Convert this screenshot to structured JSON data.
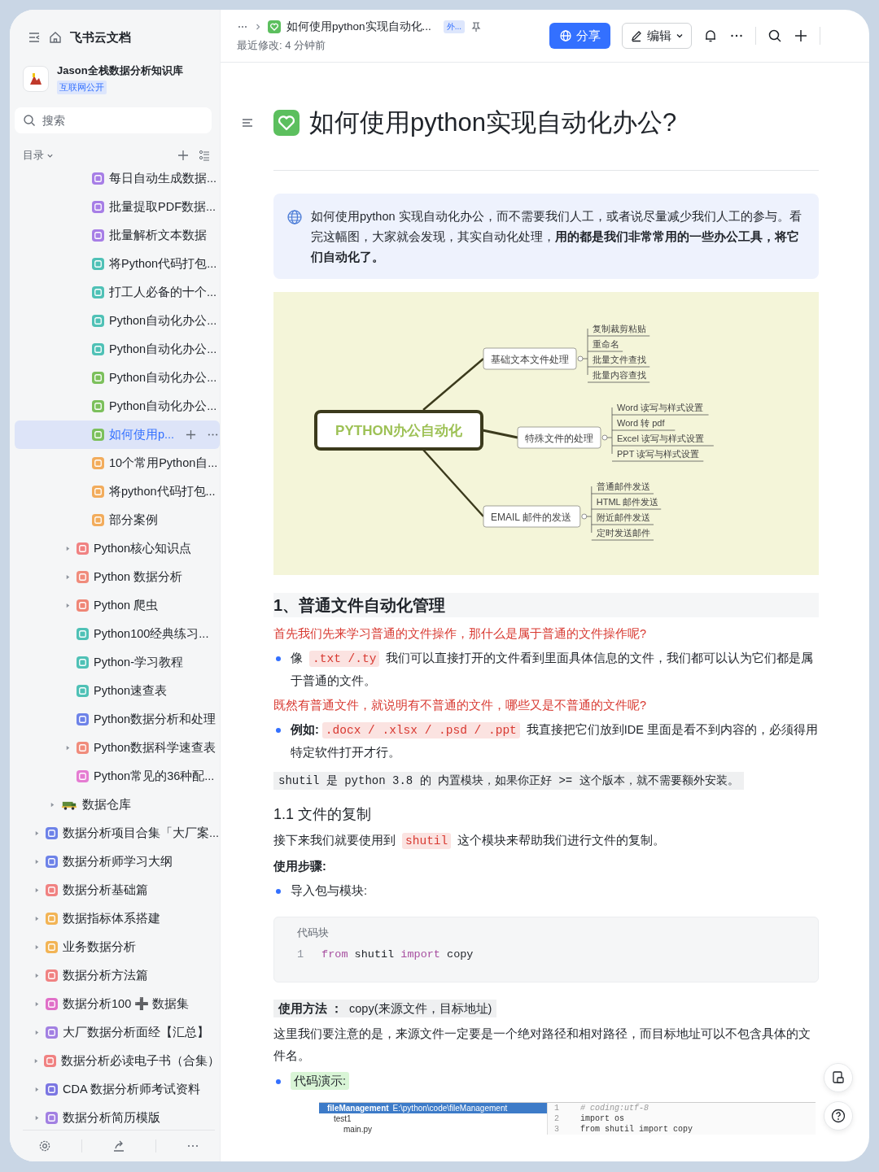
{
  "app": {
    "title": "飞书云文档"
  },
  "space": {
    "name": "Jason全栈数据分析知识库",
    "badge": "互联网公开"
  },
  "search": {
    "placeholder": "搜索"
  },
  "toc": {
    "label": "目录"
  },
  "tree": [
    {
      "children": [
        {
          "children": [
            {
              "children": [
                {
                  "label": "每日自动生成数据...",
                  "kind": "doc",
                  "color": "#a77ee6",
                  "expandable": false,
                  "selected": false
                },
                {
                  "label": "批量提取PDF数据...",
                  "kind": "doc",
                  "color": "#a77ee6",
                  "expandable": false,
                  "selected": false
                },
                {
                  "label": "批量解析文本数据",
                  "kind": "doc",
                  "color": "#a77ee6",
                  "expandable": false,
                  "selected": false
                },
                {
                  "label": "将Python代码打包...",
                  "kind": "doc",
                  "color": "#4fc1b6",
                  "expandable": false,
                  "selected": false
                },
                {
                  "label": "打工人必备的十个...",
                  "kind": "doc",
                  "color": "#4fc1b6",
                  "expandable": false,
                  "selected": false
                },
                {
                  "label": "Python自动化办公...",
                  "kind": "doc",
                  "color": "#4fc1b6",
                  "expandable": false,
                  "selected": false
                },
                {
                  "label": "Python自动化办公...",
                  "kind": "doc",
                  "color": "#4fc1b6",
                  "expandable": false,
                  "selected": false
                },
                {
                  "label": "Python自动化办公...",
                  "kind": "doc",
                  "color": "#7cc05c",
                  "expandable": false,
                  "selected": false
                },
                {
                  "label": "Python自动化办公...",
                  "kind": "doc",
                  "color": "#7cc05c",
                  "expandable": false,
                  "selected": false
                },
                {
                  "label": "如何使用p...",
                  "kind": "doc",
                  "color": "#7cc05c",
                  "expandable": false,
                  "selected": true
                },
                {
                  "label": "10个常用Python自...",
                  "kind": "doc",
                  "color": "#f2ac5c",
                  "expandable": false,
                  "selected": false
                },
                {
                  "label": "将python代码打包...",
                  "kind": "doc",
                  "color": "#f2ac5c",
                  "expandable": false,
                  "selected": false
                },
                {
                  "label": "部分案例",
                  "kind": "doc",
                  "color": "#f2ac5c",
                  "expandable": false,
                  "selected": false
                }
              ]
            },
            {
              "label": "Python核心知识点",
              "kind": "doc",
              "color": "#f08282",
              "expandable": true,
              "selected": false
            },
            {
              "label": "Python 数据分析",
              "kind": "doc",
              "color": "#f08c7c",
              "expandable": true,
              "selected": false
            },
            {
              "label": "Python 爬虫",
              "kind": "doc",
              "color": "#ef8676",
              "expandable": true,
              "selected": false
            },
            {
              "label": "Python100经典练习...",
              "kind": "doc",
              "color": "#4fc1b6",
              "expandable": false,
              "selected": false
            },
            {
              "label": "Python-学习教程",
              "kind": "doc",
              "color": "#4fc1b6",
              "expandable": false,
              "selected": false
            },
            {
              "label": "Python速查表",
              "kind": "doc",
              "color": "#4fc1b6",
              "expandable": false,
              "selected": false
            },
            {
              "label": "Python数据分析和处理",
              "kind": "doc",
              "color": "#6d82e8",
              "expandable": false,
              "selected": false
            },
            {
              "label": "Python数据科学速查表",
              "kind": "doc",
              "color": "#f08c7c",
              "expandable": true,
              "selected": false
            },
            {
              "label": "Python常见的36种配...",
              "kind": "doc",
              "color": "#e57cd2",
              "expandable": false,
              "selected": false
            }
          ]
        },
        {
          "label": "数据仓库",
          "kind": "picture",
          "expandable": true,
          "selected": false
        }
      ]
    },
    {
      "label": "数据分析项目合集「大厂案...",
      "kind": "doc",
      "color": "#6d82e8",
      "expandable": true,
      "selected": false
    },
    {
      "label": "数据分析师学习大纲",
      "kind": "doc",
      "color": "#6d82e8",
      "expandable": true,
      "selected": false
    },
    {
      "label": "数据分析基础篇",
      "kind": "doc",
      "color": "#f08282",
      "expandable": true,
      "selected": false
    },
    {
      "label": "数据指标体系搭建",
      "kind": "doc",
      "color": "#f2b455",
      "expandable": true,
      "selected": false
    },
    {
      "label": "业务数据分析",
      "kind": "doc",
      "color": "#f2b455",
      "expandable": true,
      "selected": false
    },
    {
      "label": "数据分析方法篇",
      "kind": "doc",
      "color": "#f08282",
      "expandable": true,
      "selected": false
    },
    {
      "label": "数据分析100 ➕ 数据集",
      "kind": "doc",
      "color": "#e070c8",
      "expandable": true,
      "selected": false
    },
    {
      "label": "大厂数据分析面经【汇总】",
      "kind": "doc",
      "color": "#a280e2",
      "expandable": true,
      "selected": false
    },
    {
      "label": "数据分析必读电子书（合集）",
      "kind": "doc",
      "color": "#f08282",
      "expandable": true,
      "selected": false
    },
    {
      "label": "CDA 数据分析师考试资料",
      "kind": "doc",
      "color": "#7b76e2",
      "expandable": true,
      "selected": false
    },
    {
      "label": "数据分析简历模版",
      "kind": "doc",
      "color": "#a280e2",
      "expandable": true,
      "selected": false
    }
  ],
  "topbar": {
    "doc_title": "如何使用python实现自动化...",
    "badge": "外...",
    "modified": "最近修改: 4 分钟前",
    "share": "分享",
    "edit": "编辑"
  },
  "document": {
    "title": "如何使用python实现自动化办公?",
    "callout": "如何使用python 实现自动化办公，而不需要我们人工，或者说尽量减少我们人工的参与。看完这幅图，大家就会发现，其实自动化处理，**用的都是我们非常常用的一些办公工具，将它们自动化了。**",
    "mindmap": {
      "root": "PYTHON办公自动化",
      "branches": [
        {
          "label": "基础文本文件处理",
          "leaves": [
            "复制裁剪粘贴",
            "重命名",
            "批量文件查找",
            "批量内容查找"
          ]
        },
        {
          "label": "特殊文件的处理",
          "leaves": [
            "Word 读写与样式设置",
            "Word 转 pdf",
            "Excel 读写与样式设置",
            "PPT 读写与样式设置"
          ]
        },
        {
          "label": "EMAIL 邮件的发送",
          "leaves": [
            "普通邮件发送",
            "HTML 邮件发送",
            "附近邮件发送",
            "定时发送邮件"
          ]
        }
      ]
    },
    "blocks": [
      {
        "kind": "heading",
        "text": "1、普通文件自动化管理"
      },
      {
        "kind": "note",
        "text": "首先我们先来学习普通的文件操作，那什么是属于普通的文件操作呢?"
      },
      {
        "kind": "bullet",
        "segments": [
          {
            "kind": "text",
            "text": "像 "
          },
          {
            "kind": "code",
            "text": ".txt /.ty"
          },
          {
            "kind": "text",
            "text": " 我们可以直接打开的文件看到里面具体信息的文件，我们都可以认为它们都是属于普通的文件。"
          }
        ]
      },
      {
        "kind": "note",
        "text": "既然有普通文件，就说明有不普通的文件，哪些又是不普通的文件呢?"
      },
      {
        "kind": "bullet",
        "segments": [
          {
            "kind": "bold",
            "text": "例如:"
          },
          {
            "kind": "code",
            "text": ".docx / .xlsx / .psd / .ppt"
          },
          {
            "kind": "text",
            "text": " 我直接把它们放到IDE 里面是看不到内容的，必须得用特定软件打开才行。"
          }
        ]
      },
      {
        "kind": "highlight",
        "text": "shutil 是 python 3.8 的 内置模块，如果你正好 >= 这个版本，就不需要额外安装。"
      },
      {
        "kind": "subheading",
        "text": "1.1 文件的复制"
      },
      {
        "kind": "paragraph",
        "segments": [
          {
            "kind": "text",
            "text": "接下来我们就要使用到 "
          },
          {
            "kind": "code",
            "text": "shutil"
          },
          {
            "kind": "text",
            "text": " 这个模块来帮助我们进行文件的复制。"
          }
        ]
      },
      {
        "kind": "label",
        "text": "使用步骤:"
      },
      {
        "kind": "bullet",
        "segments": [
          {
            "kind": "text",
            "text": "导入包与模块:"
          }
        ]
      },
      {
        "kind": "code",
        "caption": "代码块",
        "lines": [
          {
            "number": "1",
            "tokens": [
              {
                "kind": "keyword",
                "text": "from"
              },
              {
                "kind": "plain",
                "text": " shutil "
              },
              {
                "kind": "keyword",
                "text": "import"
              },
              {
                "kind": "plain",
                "text": " copy"
              }
            ]
          }
        ]
      },
      {
        "kind": "usage",
        "segments": [
          {
            "kind": "bold",
            "text": "使用方法 ："
          },
          {
            "kind": "text",
            "text": " copy(来源文件，目标地址)"
          }
        ]
      },
      {
        "kind": "paragraph",
        "segments": [
          {
            "kind": "text",
            "text": "这里我们要注意的是，来源文件一定要是一个绝对路径和相对路径，而目标地址可以不包含具体的文件名。"
          }
        ]
      },
      {
        "kind": "bullet",
        "segments": [
          {
            "kind": "mark",
            "text": "代码演示:"
          }
        ]
      },
      {
        "kind": "ide",
        "project": "fileManagement",
        "path": "E:\\python\\code\\fileManagement",
        "files": [
          "test1",
          "main.py"
        ],
        "lines": [
          {
            "number": "1",
            "kind": "comment",
            "text": "# coding:utf-8"
          },
          {
            "number": "2",
            "kind": "code",
            "text": "import os"
          },
          {
            "number": "3",
            "kind": "code",
            "text": "from shutil import copy"
          }
        ]
      }
    ]
  }
}
